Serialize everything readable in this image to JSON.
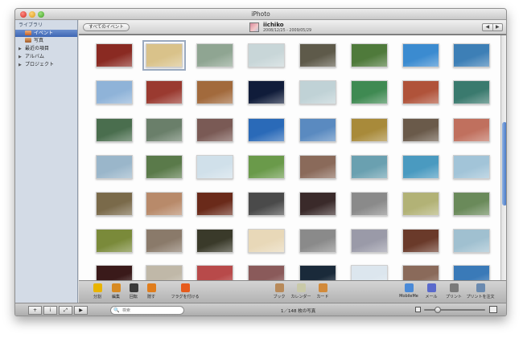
{
  "window": {
    "title": "iPhoto"
  },
  "sidebar": {
    "library_heading": "ライブラリ",
    "items": [
      {
        "label": "イベント",
        "icon": "event-icon",
        "selected": true
      },
      {
        "label": "写真",
        "icon": "photos-icon",
        "selected": false
      }
    ],
    "groups": [
      {
        "label": "最近の項目",
        "icon": "disclosure-triangle-icon"
      },
      {
        "label": "アルバム",
        "icon": "disclosure-triangle-icon"
      },
      {
        "label": "プロジェクト",
        "icon": "disclosure-triangle-icon"
      }
    ]
  },
  "header": {
    "back_label": "すべてのイベント",
    "event_title": "iichiko",
    "event_dates": "2008/12/25 - 2009/05/29",
    "prev_glyph": "◀",
    "next_glyph": "▶"
  },
  "photos": [
    [
      "#8a2a22",
      "#d9c28a",
      "#8fa592",
      "#c8d6d8",
      "#5e5a4a",
      "#4f7a3b",
      "#3b8bd0",
      "#3d7fb6"
    ],
    [
      "#8fb3d8",
      "#9a3a30",
      "#a26a3c",
      "#101c3a",
      "#c0d2d6",
      "#3f8a52",
      "#b0533a",
      "#3a7a6e"
    ],
    [
      "#4a6e4e",
      "#6a7f6a",
      "#7a5a55",
      "#2a6ab8",
      "#5a8ac0",
      "#a88a3a",
      "#6a5a4a",
      "#c0705e"
    ],
    [
      "#9ab6ca",
      "#5a7a4a",
      "#d0e0ea",
      "#6a9a4a",
      "#8a6a5a",
      "#6aa0b0",
      "#4a9ac0",
      "#a2c4d8"
    ],
    [
      "#7a6a4a",
      "#b88a6a",
      "#6a2a1a",
      "#4a4a4a",
      "#3a2a2a",
      "#8a8a8a",
      "#b2b276",
      "#6a8a5a"
    ],
    [
      "#7a8a3a",
      "#8a7a6a",
      "#3a3a2a",
      "#e8d8b8",
      "#8a8a8a",
      "#9a9aa8",
      "#6a3a2a",
      "#a0c0d0"
    ],
    [
      "#3a1a1a",
      "#c0b8a8",
      "#b84a4a",
      "#8a5a5a",
      "#1a2a3a",
      "#dce6ee",
      "#8a6a5a",
      "#3a7ab8"
    ]
  ],
  "toolbar": {
    "left_tools": [
      {
        "label": "分割",
        "icon": "split-icon",
        "color": "#e9b400"
      },
      {
        "label": "編集",
        "icon": "edit-pencil-icon",
        "color": "#d78a22"
      },
      {
        "label": "回転",
        "icon": "rotate-icon",
        "color": "#3a3a3a"
      },
      {
        "label": "隠す",
        "icon": "hide-x-icon",
        "color": "#e07d1c"
      },
      {
        "label": "フラグを付ける",
        "icon": "flag-icon",
        "color": "#e65b1c"
      }
    ],
    "center_tools": [
      {
        "label": "ブック",
        "icon": "book-icon",
        "color": "#b88a5a"
      },
      {
        "label": "カレンダー",
        "icon": "calendar-icon",
        "color": "#c9c9a8"
      },
      {
        "label": "カード",
        "icon": "card-icon",
        "color": "#d28a3a"
      }
    ],
    "right_tools": [
      {
        "label": "MobileMe",
        "icon": "mobileme-cloud-icon",
        "color": "#4a8ad8"
      },
      {
        "label": "メール",
        "icon": "mail-icon",
        "color": "#5a6acc"
      },
      {
        "label": "プリント",
        "icon": "print-icon",
        "color": "#7a7a7a"
      },
      {
        "label": "プリントを注文",
        "icon": "order-prints-icon",
        "color": "#6a8ab0"
      }
    ]
  },
  "bottombar": {
    "add_glyph": "+",
    "info_glyph": "i",
    "fullscreen_glyph": "⤢",
    "play_glyph": "▶",
    "search_icon_glyph": "🔍",
    "search_placeholder": "検索",
    "photo_count": "1／148 枚の写真",
    "zoom_level": 0.22
  }
}
